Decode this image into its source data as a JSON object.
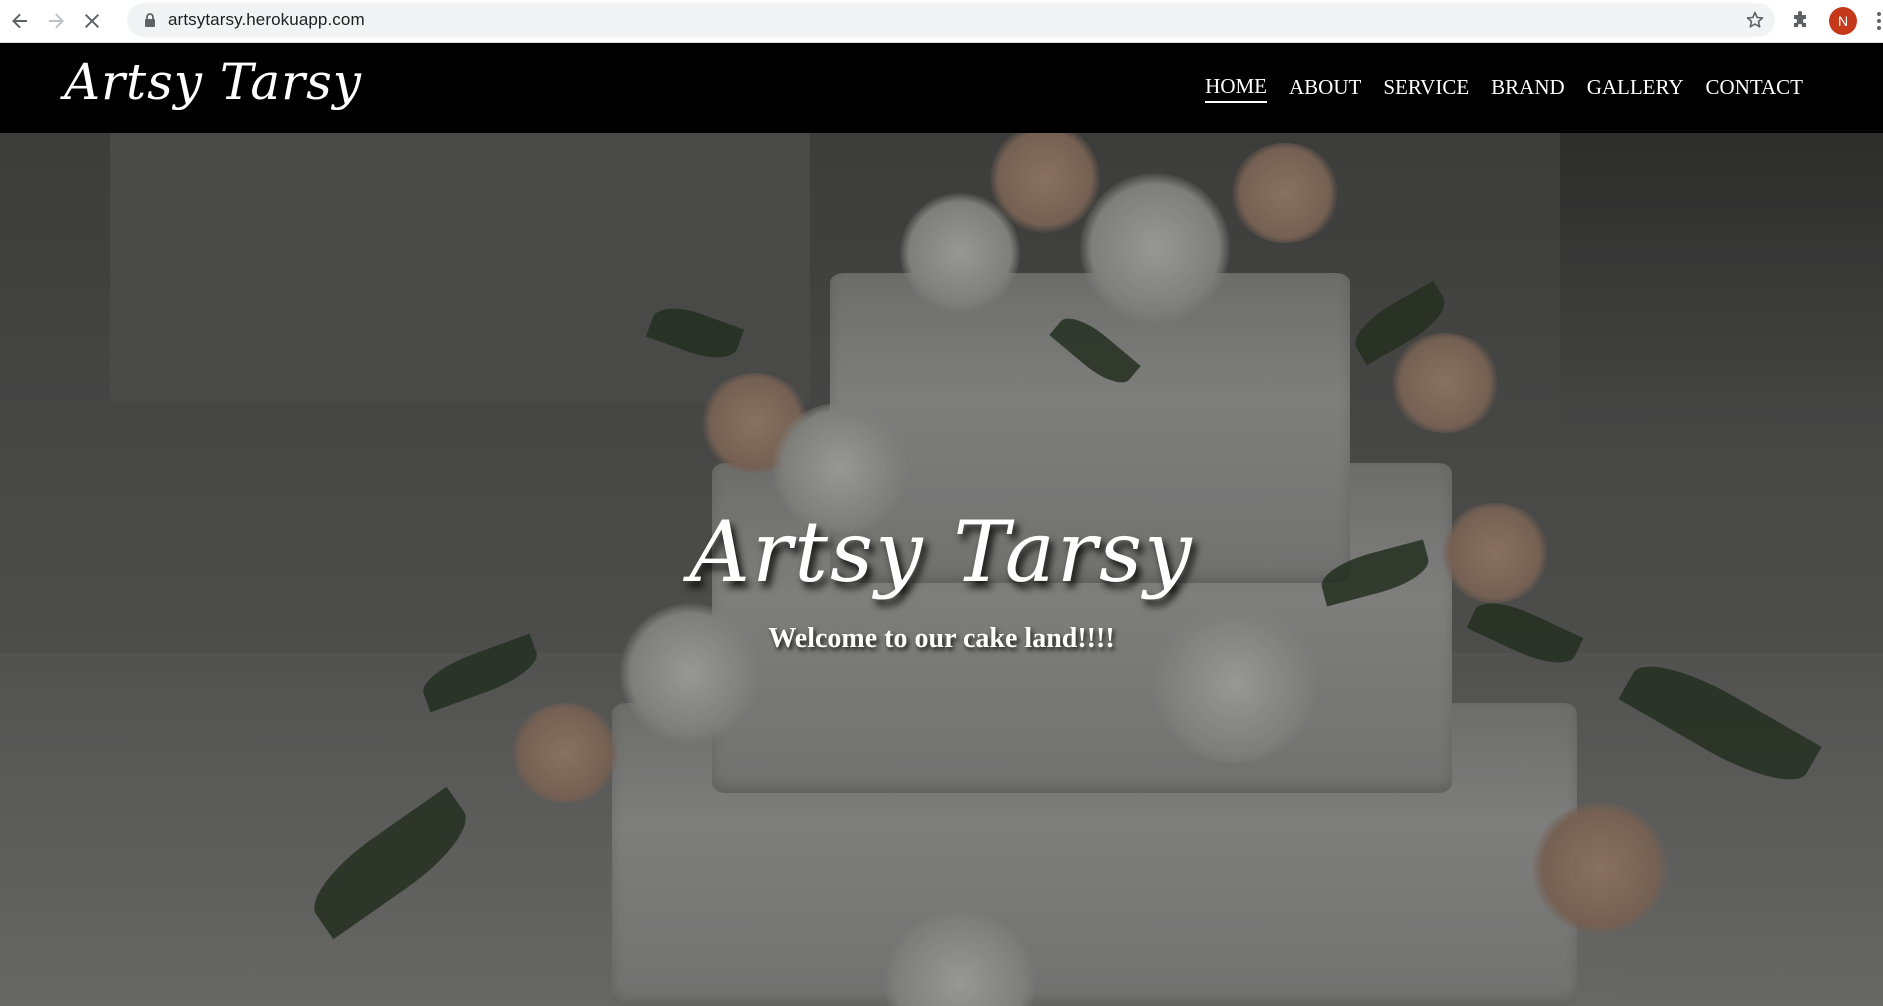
{
  "browser": {
    "url": "artsytarsy.herokuapp.com",
    "profile_initial": "N",
    "icons": {
      "back": "arrow-left-icon",
      "forward": "arrow-right-icon",
      "stop": "close-icon",
      "lock": "lock-icon",
      "bookmark": "star-icon",
      "extensions": "puzzle-icon",
      "menu": "more-vert-icon"
    }
  },
  "site": {
    "brand": "Artsy Tarsy",
    "nav": {
      "items": [
        {
          "label": "HOME",
          "active": true
        },
        {
          "label": "ABOUT",
          "active": false
        },
        {
          "label": "SERVICE",
          "active": false
        },
        {
          "label": "BRAND",
          "active": false
        },
        {
          "label": "GALLERY",
          "active": false
        },
        {
          "label": "CONTACT",
          "active": false
        }
      ]
    },
    "hero": {
      "title": "Artsy Tarsy",
      "subtitle": "Welcome to our cake land!!!!"
    }
  },
  "colors": {
    "navbar_bg": "#000000",
    "text": "#ffffff",
    "avatar_bg": "#c5391a"
  }
}
